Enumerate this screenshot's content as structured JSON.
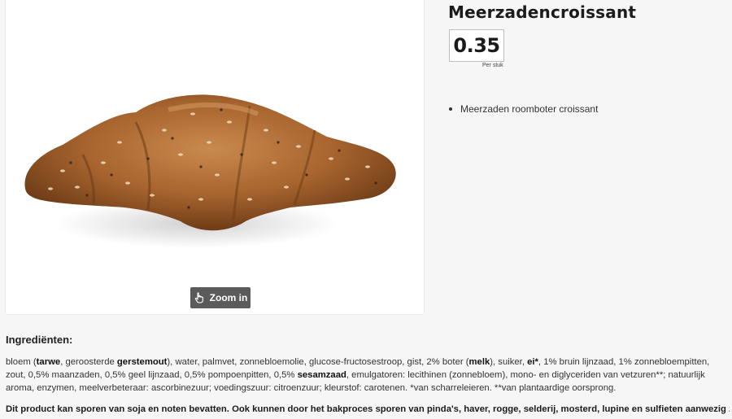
{
  "product": {
    "title": "Meerzadencroissant",
    "price": "0.35",
    "unit": "Per stuk",
    "features": [
      "Meerzaden roomboter croissant"
    ]
  },
  "image": {
    "icon": "croissant-photo",
    "zoom_label": "Zoom in",
    "zoom_icon": "hand-pointer-icon"
  },
  "ingredients": {
    "heading": "Ingrediënten:",
    "segments": [
      {
        "text": "bloem (",
        "bold": false
      },
      {
        "text": "tarwe",
        "bold": true
      },
      {
        "text": ", geroosterde ",
        "bold": false
      },
      {
        "text": "gerstemout",
        "bold": true
      },
      {
        "text": "), water, palmvet, zonnebloemolie, glucose-fructosestroop, gist, 2% boter (",
        "bold": false
      },
      {
        "text": "melk",
        "bold": true
      },
      {
        "text": "), suiker, ",
        "bold": false
      },
      {
        "text": "ei*",
        "bold": true
      },
      {
        "text": ", 1% bruin lijnzaad, 1% zonnebloempitten, zout, 0,5% maanzaden, 0,5% geel lijnzaad, 0,5% pompoenpitten, 0,5% ",
        "bold": false
      },
      {
        "text": "sesamzaad",
        "bold": true
      },
      {
        "text": ", emulgatoren: lecithinen (zonnebloem), mono- en diglyceriden van vetzuren**; natuurlijk aroma, enzymen, meelverbeteraar: ascorbinezuur; voedingszuur: citroenzuur; kleurstof: carotenen. *van scharreleieren. **van plantaardige oorsprong.",
        "bold": false
      }
    ],
    "allergen_note": "Dit product kan sporen van soja en noten bevatten. Ook kunnen door het bakproces sporen van pinda's, haver, rogge, selderij, mosterd, lupine en sulfieten aanwezig zijn"
  },
  "colors": {
    "background": "#f6f6f6",
    "zoom_button": "#5b5b5b",
    "croissant": "#b8733a"
  }
}
